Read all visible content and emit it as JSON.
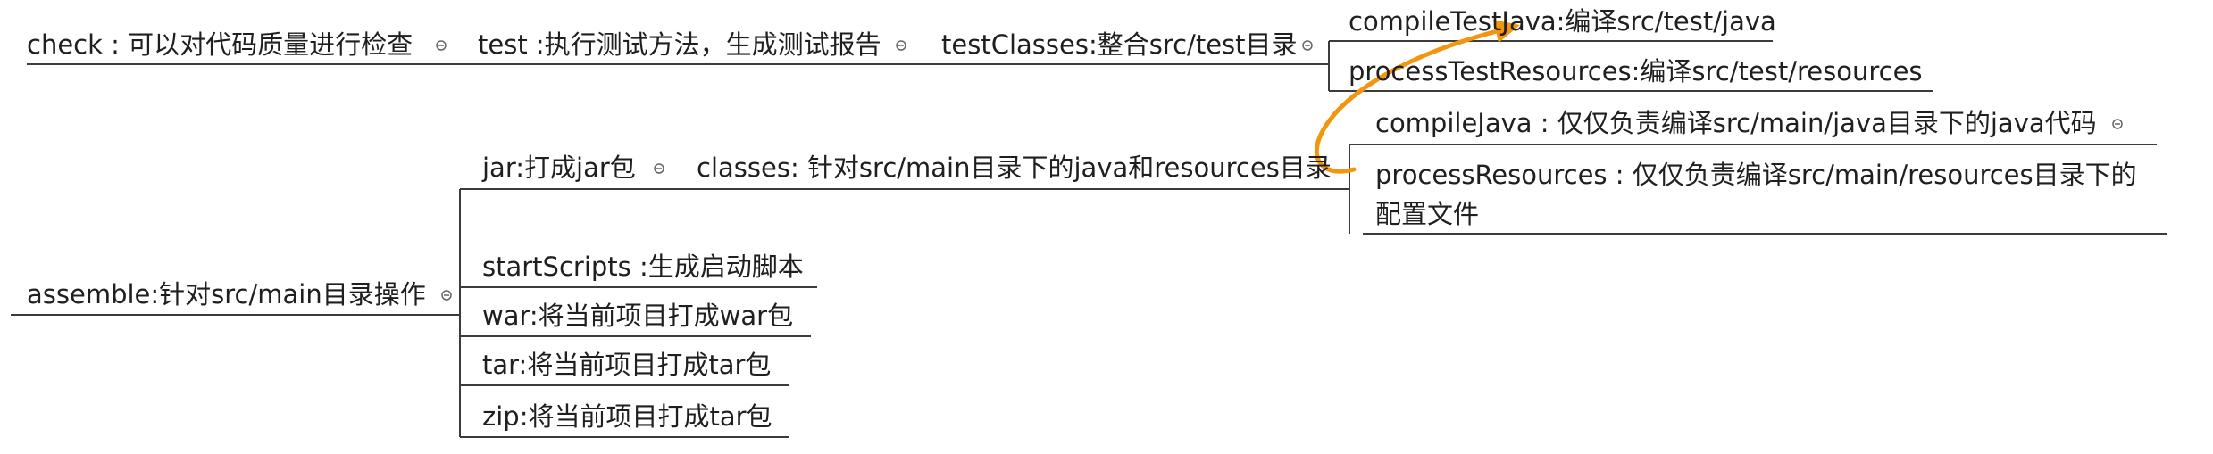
{
  "mindmap": {
    "nodes": {
      "check": "check : 可以对代码质量进行检查",
      "test": "test :执行测试方法，生成测试报告",
      "testClasses": "testClasses:整合src/test目录",
      "compileTestJava": "compileTestJava:编译src/test/java",
      "processTestResources": "processTestResources:编译src/test/resources",
      "compileJava": "compileJava : 仅仅负责编译src/main/java目录下的java代码",
      "processResources": "processResources : 仅仅负责编译src/main/resources目录下的配置文件",
      "jar": "jar:打成jar包",
      "classes": "classes: 针对src/main目录下的java和resources目录",
      "assemble": "assemble:针对src/main目录操作",
      "startScripts": "startScripts :生成启动脚本",
      "war": "war:将当前项目打成war包",
      "tar": "tar:将当前项目打成tar包",
      "zip": "zip:将当前项目打成tar包"
    },
    "colors": {
      "line": "#3c3c3c",
      "arrow": "#f2960f",
      "toggle": "#666666"
    },
    "icons": {
      "collapse": "collapse-circle-icon"
    }
  }
}
